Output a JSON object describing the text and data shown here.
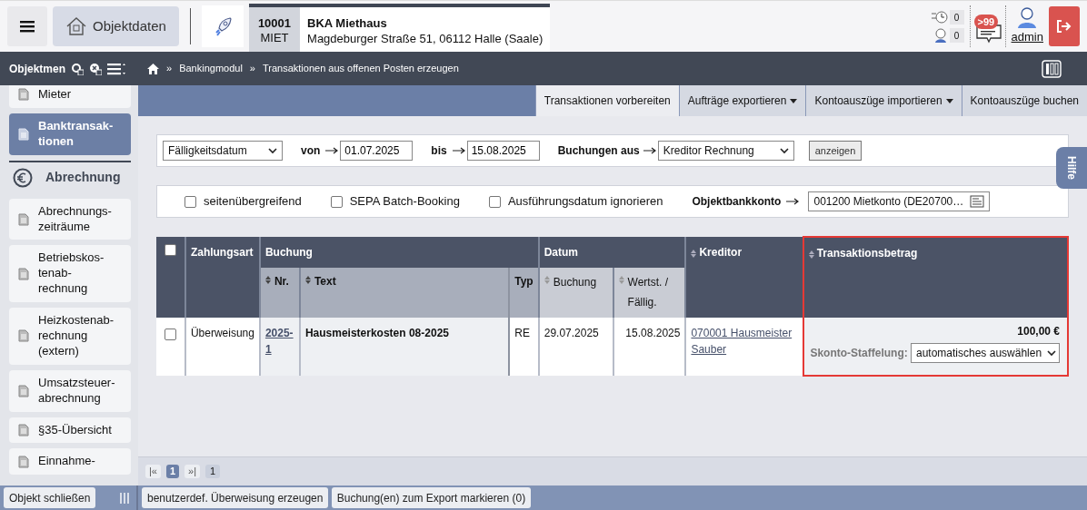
{
  "header": {
    "objektdaten_label": "Objektdaten",
    "object": {
      "number": "10001",
      "type": "MIET",
      "name": "BKA Miethaus",
      "address": "Magdeburger Straße 51, 06112 Halle (Saale)"
    },
    "counters": [
      {
        "value": "0"
      },
      {
        "value": "0"
      }
    ],
    "messages_badge": ">99",
    "user": "admin"
  },
  "toolbar": {
    "menu_label": "Objektmen",
    "breadcrumb": [
      {
        "separator": "»",
        "label": "Bankingmodul"
      },
      {
        "separator": "»",
        "label": "Transaktionen aus offenen Posten erzeugen"
      }
    ]
  },
  "sidebar": {
    "items": [
      {
        "kind": "item",
        "label": "Mieter",
        "selected": false
      },
      {
        "kind": "item",
        "label": "Banktransak-\ntionen",
        "selected": true
      },
      {
        "kind": "section",
        "label": "Abrechnung"
      },
      {
        "kind": "item",
        "label": "Abrechnungs-\nzeiträume",
        "selected": false
      },
      {
        "kind": "item",
        "label": "Betriebskos-\ntenab-\nrechnung",
        "selected": false
      },
      {
        "kind": "item",
        "label": "Heizkostenab-\nrechnung\n(extern)",
        "selected": false
      },
      {
        "kind": "item",
        "label": "Umsatzsteuer-\nabrechnung",
        "selected": false
      },
      {
        "kind": "item",
        "label": "§35-Übersicht",
        "selected": false
      },
      {
        "kind": "item",
        "label": "Einnahme-",
        "selected": false
      }
    ],
    "close_button": "Objekt schließen"
  },
  "tabs": [
    {
      "label": "Transaktionen vorbereiten",
      "selected": true,
      "dropdown": false
    },
    {
      "label": "Aufträge exportieren",
      "selected": false,
      "dropdown": true
    },
    {
      "label": "Kontoauszüge importieren",
      "selected": false,
      "dropdown": true
    },
    {
      "label": "Kontoauszüge buchen",
      "selected": false,
      "dropdown": false
    }
  ],
  "filters": {
    "date_type": "Fälligkeitsdatum",
    "from_label": "von",
    "from_value": "01.07.2025",
    "to_label": "bis",
    "to_value": "15.08.2025",
    "source_label": "Buchungen aus",
    "source_value": "Kreditor Rechnung",
    "show_button": "anzeigen"
  },
  "options": {
    "checkboxes": [
      {
        "label": "seitenübergreifend",
        "checked": false
      },
      {
        "label": "SEPA Batch-Booking",
        "checked": false
      },
      {
        "label": "Ausführungsdatum ignorieren",
        "checked": false
      }
    ],
    "bank_account_label": "Objektbankkonto",
    "bank_account_value": "001200 Mietkonto (DE20700…"
  },
  "help_tab": "Hilfe",
  "table": {
    "select_all_checked": false,
    "groups": [
      {
        "label": "Zahlungsart",
        "sortable": false,
        "highlighted": false
      },
      {
        "label": "Buchung",
        "sortable": false,
        "highlighted": false,
        "columns": [
          {
            "label": "Nr.",
            "sortable": true,
            "bold": true
          },
          {
            "label": "Text",
            "sortable": true,
            "bold": true
          },
          {
            "label": "Typ",
            "sortable": false,
            "bold": true
          }
        ]
      },
      {
        "label": "Datum",
        "sortable": false,
        "highlighted": false,
        "columns": [
          {
            "label": "Buchung",
            "sortable": true,
            "bold": false
          },
          {
            "label": "Wertst. /\nFällig.",
            "sortable": true,
            "bold": false
          }
        ]
      },
      {
        "label": "Kreditor",
        "sortable": true,
        "highlighted": false
      },
      {
        "label": "Transaktionsbetrag",
        "sortable": true,
        "highlighted": true
      }
    ],
    "rows": [
      {
        "checked": false,
        "zahlungsart": "Überweisung",
        "nr": "2025-\n1",
        "text": "Hausmeisterkosten 08-2025",
        "typ": "RE",
        "buchung": "29.07.2025",
        "faellig": "15.08.2025",
        "kreditor": "070001 Hausmeister\nSauber",
        "betrag": "100,00 €",
        "skonto_label": "Skonto-Staffelung:",
        "skonto_value": "automatisches auswählen"
      }
    ]
  },
  "pager": {
    "first": "|«",
    "pages": [
      {
        "label": "1",
        "selected": true
      }
    ],
    "last": "»|",
    "total": "1"
  },
  "footer_buttons": [
    "benutzerdef. Überweisung erzeugen",
    "Buchung(en) zum Export markieren (0)"
  ]
}
